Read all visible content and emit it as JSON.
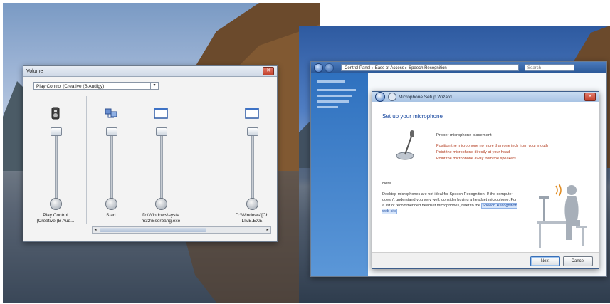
{
  "volume_window": {
    "title": "Volume",
    "device_selector": "Play Control (Creative (B Audigy)",
    "channels": [
      {
        "label": "Play Control\n(Creative (B Aud..."
      },
      {
        "label": "Start"
      },
      {
        "label": "D:\\Windows\\syste\nm32\\Sserbang.exe"
      },
      {
        "label": "D:\\Windows\\[Ch\nLIVE.EXE"
      }
    ]
  },
  "control_panel": {
    "address_path": "Control Panel  ▸  Ease of Access  ▸  Speech Recognition",
    "search_placeholder": "Search"
  },
  "mic_wizard": {
    "title": "Microphone Setup Wizard",
    "heading": "Set up your microphone",
    "placement_title": "Proper microphone placement",
    "tips": [
      "Position the microphone no more than one inch from your mouth",
      "Point the microphone directly at your head",
      "Point the microphone away from the speakers"
    ],
    "note_title": "Note",
    "note_text": "Desktop microphones are not ideal for Speech Recognition. If the computer doesn't understand you very well, consider buying a headset microphone. For a list of recommended headset microphones, refer to the",
    "note_link": "Speech Recognition web site",
    "next_label": "Next",
    "cancel_label": "Cancel"
  }
}
